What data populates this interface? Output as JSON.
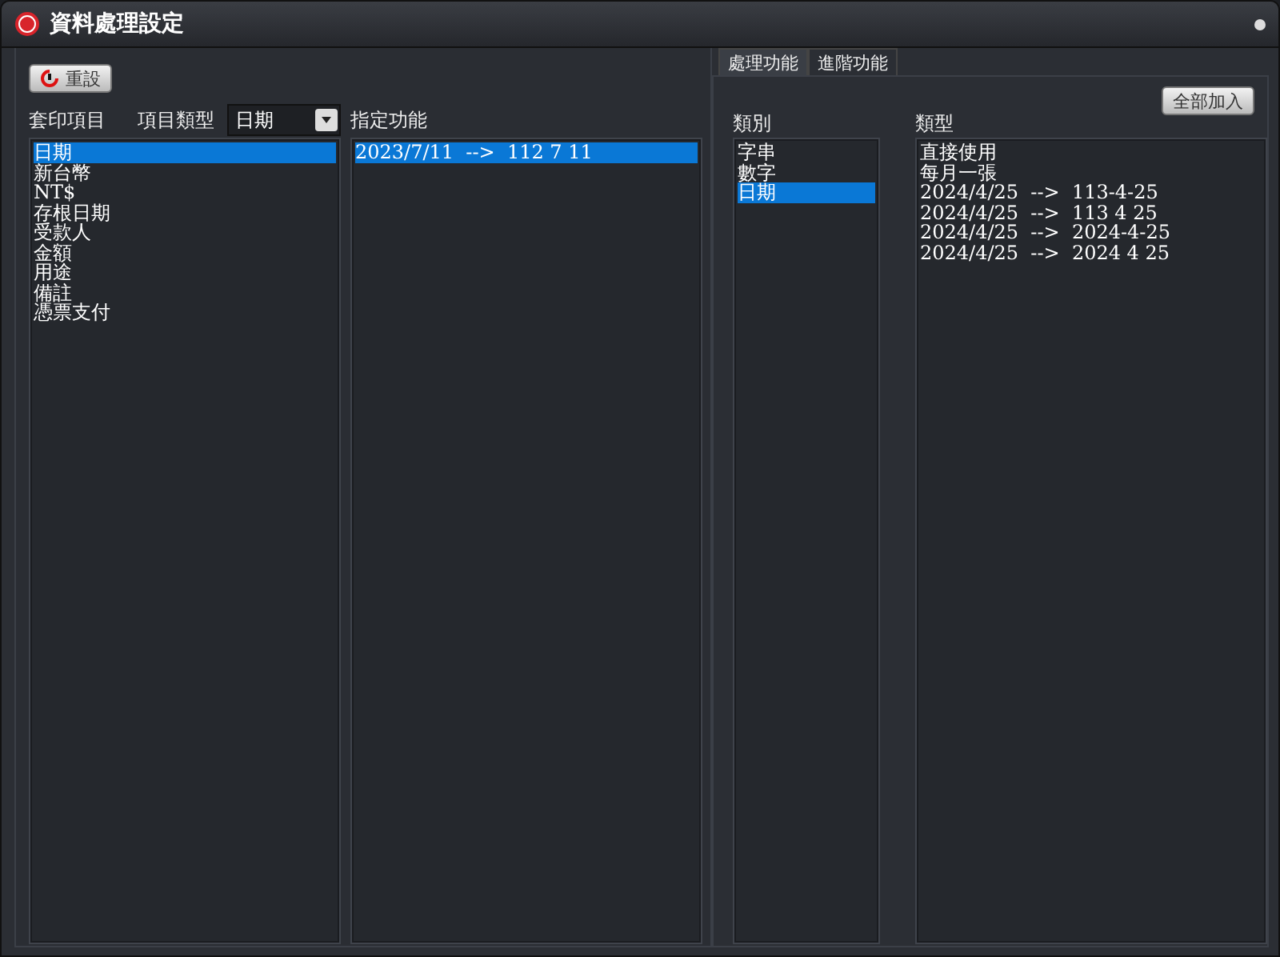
{
  "window": {
    "title": "資料處理設定"
  },
  "reset_button": {
    "label": "重設"
  },
  "print_items": {
    "label": "套印項目",
    "items": [
      {
        "text": "日期",
        "selected": true
      },
      {
        "text": "新台幣",
        "selected": false
      },
      {
        "text": "NT$",
        "selected": false
      },
      {
        "text": "存根日期",
        "selected": false
      },
      {
        "text": "受款人",
        "selected": false
      },
      {
        "text": "金額",
        "selected": false
      },
      {
        "text": "用途",
        "selected": false
      },
      {
        "text": "備註",
        "selected": false
      },
      {
        "text": "憑票支付",
        "selected": false
      }
    ]
  },
  "item_type": {
    "label": "項目類型",
    "value": "日期"
  },
  "assigned": {
    "label": "指定功能",
    "items": [
      {
        "text": "2023/7/11  -->  112 7 11",
        "selected": true
      }
    ]
  },
  "tabs": [
    {
      "label": "處理功能",
      "selected": true
    },
    {
      "label": "進階功能",
      "selected": false
    }
  ],
  "add_all_button": {
    "label": "全部加入"
  },
  "category": {
    "label": "類別",
    "items": [
      {
        "text": "字串",
        "selected": false
      },
      {
        "text": "數字",
        "selected": false
      },
      {
        "text": "日期",
        "selected": true
      }
    ]
  },
  "types": {
    "label": "類型",
    "items": [
      {
        "text": "直接使用",
        "selected": false
      },
      {
        "text": "每月一張",
        "selected": false
      },
      {
        "text": "2024/4/25  -->  113-4-25",
        "selected": false
      },
      {
        "text": "2024/4/25  -->  113 4 25",
        "selected": false
      },
      {
        "text": "2024/4/25  -->  2024-4-25",
        "selected": false
      },
      {
        "text": "2024/4/25  -->  2024 4 25",
        "selected": false
      }
    ]
  }
}
